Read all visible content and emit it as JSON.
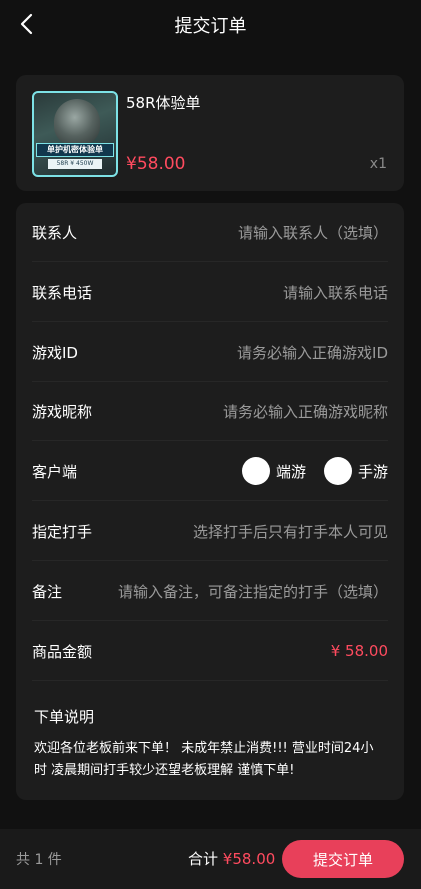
{
  "header": {
    "title": "提交订单"
  },
  "product": {
    "name": "58R体验单",
    "price": "¥58.00",
    "quantity": "x1",
    "image": {
      "banner_text": "单护机密体验单",
      "sub_text": "58R ¥ 450W"
    }
  },
  "form": {
    "contact": {
      "label": "联系人",
      "placeholder": "请输入联系人（选填）"
    },
    "phone": {
      "label": "联系电话",
      "placeholder": "请输入联系电话"
    },
    "game_id": {
      "label": "游戏ID",
      "placeholder": "请务必输入正确游戏ID"
    },
    "nickname": {
      "label": "游戏昵称",
      "placeholder": "请务必输入正确游戏昵称"
    },
    "client": {
      "label": "客户端",
      "options": [
        "端游",
        "手游"
      ]
    },
    "player": {
      "label": "指定打手",
      "placeholder": "选择打手后只有打手本人可见"
    },
    "remark": {
      "label": "备注",
      "placeholder": "请输入备注，可备注指定的打手（选填）"
    },
    "amount": {
      "label": "商品金额",
      "value": "¥ 58.00"
    }
  },
  "notice": {
    "title": "下单说明",
    "text": "欢迎各位老板前来下单！ 未成年禁止消费!!! 营业时间24小时 凌晨期间打手较少还望老板理解 谨慎下单!"
  },
  "footer": {
    "count": "共 1 件",
    "total_label": "合计",
    "total_amount": "¥58.00",
    "submit_label": "提交订单"
  },
  "colors": {
    "accent": "#ff4b5f",
    "button": "#e8405a",
    "card": "#1d1d1d",
    "background": "#111111"
  }
}
